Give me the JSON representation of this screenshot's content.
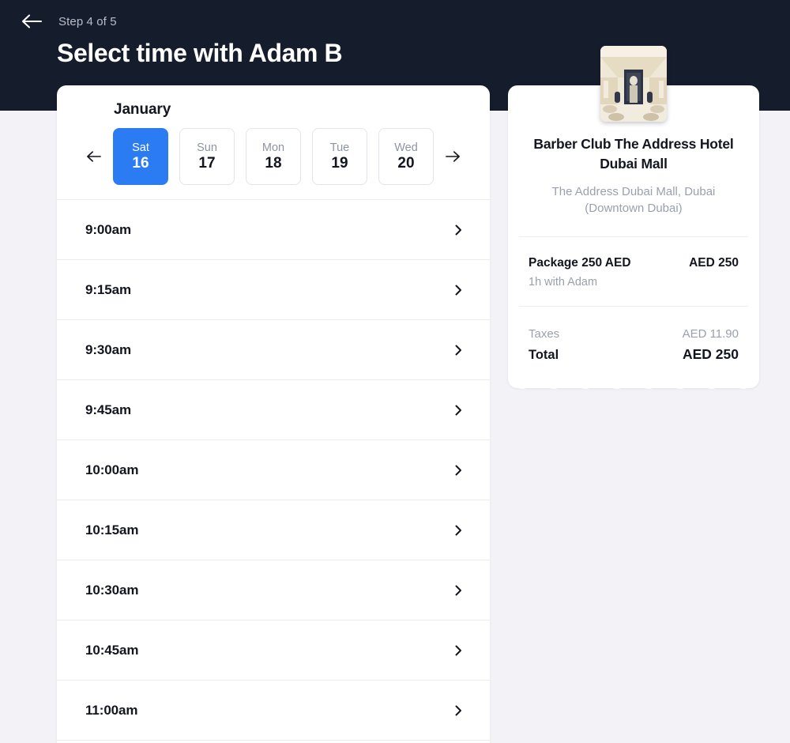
{
  "header": {
    "back_icon": "arrow-left-icon",
    "step_label": "Step 4 of 5",
    "title": "Select time with Adam B",
    "background_color": "#151c2c"
  },
  "theme": {
    "page_background": "#f2f2f7",
    "accent_color": "#2b7bf3",
    "card_background": "#ffffff",
    "text_primary": "#14161f",
    "text_muted": "#9aa0ad",
    "divider": "#ebecf1"
  },
  "calendar": {
    "month": "January",
    "prev_icon": "arrow-left-icon",
    "next_icon": "arrow-right-icon",
    "days": [
      {
        "dow": "Sat",
        "dom": "16",
        "selected": true
      },
      {
        "dow": "Sun",
        "dom": "17",
        "selected": false
      },
      {
        "dow": "Mon",
        "dom": "18",
        "selected": false
      },
      {
        "dow": "Tue",
        "dom": "19",
        "selected": false
      },
      {
        "dow": "Wed",
        "dom": "20",
        "selected": false
      }
    ]
  },
  "slots": {
    "chevron_icon": "chevron-right-icon",
    "times": [
      "9:00am",
      "9:15am",
      "9:30am",
      "9:45am",
      "10:00am",
      "10:15am",
      "10:30am",
      "10:45am",
      "11:00am"
    ]
  },
  "summary": {
    "thumbnail_icon": "barbershop-interior-photo",
    "business_name": "Barber Club The Address Hotel Dubai Mall",
    "address": "The Address Dubai Mall, Dubai (Downtown Dubai)",
    "item": {
      "name": "Package 250 AED",
      "price": "AED 250",
      "detail": "1h with Adam"
    },
    "taxes_label": "Taxes",
    "taxes_value": "AED 11.90",
    "total_label": "Total",
    "total_value": "AED 250"
  }
}
